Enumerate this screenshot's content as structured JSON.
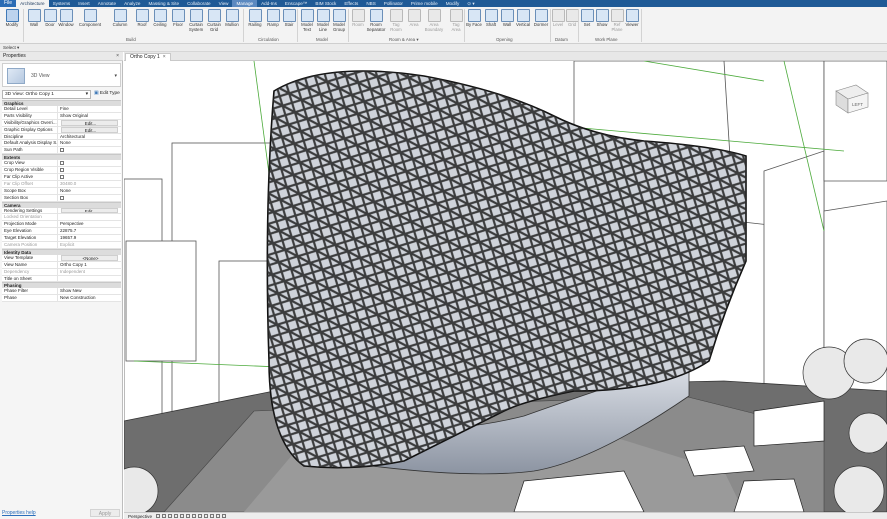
{
  "tabs": {
    "file": "File",
    "items": [
      "Architecture",
      "Systems",
      "Insert",
      "Annotate",
      "Analyze",
      "Massing & Site",
      "Collaborate",
      "View",
      "Manage",
      "Add-Ins",
      "Enscape™",
      "BIM Stock",
      "Effects",
      "NBS",
      "Pollinator",
      "Prime mobile",
      "Modify",
      "⊙ ▾"
    ]
  },
  "ribbon": {
    "buttons": [
      "Modify",
      "Wall",
      "Door",
      "Window",
      "Component",
      "Column",
      "Roof",
      "Ceiling",
      "Floor",
      "Curtain System",
      "Curtain Grid",
      "Mullion",
      "Railing",
      "Ramp",
      "Stair",
      "Model Text",
      "Model Line",
      "Model Group",
      "Room",
      "Room Separator",
      "Tag Room",
      "Area",
      "Area Boundary",
      "Tag Area",
      "By Face",
      "Shaft",
      "Wall",
      "Vertical",
      "Dormer",
      "Level",
      "Grid",
      "Set",
      "Show",
      "Ref Plane",
      "Viewer"
    ],
    "panels": [
      "Build",
      "Circulation",
      "Model",
      "Room & Area ▾",
      "Opening",
      "Datum",
      "Work Plane"
    ],
    "select_label": "Select ▾"
  },
  "properties": {
    "title": "Properties",
    "close": "×",
    "type_name": "3D View",
    "instance_selector": "3D View: Ortho Copy 1",
    "edit_type": "Edit Type",
    "groups": [
      {
        "name": "Graphics",
        "rows": [
          [
            "Detail Level",
            "Fine"
          ],
          [
            "Parts Visibility",
            "Show Original"
          ],
          [
            "Visibility/Graphics Overri...",
            "Edit..."
          ],
          [
            "Graphic Display Options",
            "Edit..."
          ],
          [
            "Discipline",
            "Architectural"
          ],
          [
            "Default Analysis Display S...",
            "None"
          ],
          [
            "Sun Path",
            ""
          ]
        ]
      },
      {
        "name": "Extents",
        "rows": [
          [
            "Crop View",
            ""
          ],
          [
            "Crop Region Visible",
            ""
          ],
          [
            "Far Clip Active",
            ""
          ],
          [
            "Far Clip Offset",
            "30480.0"
          ],
          [
            "Scope Box",
            "None"
          ],
          [
            "Section Box",
            ""
          ]
        ]
      },
      {
        "name": "Camera",
        "rows": [
          [
            "Rendering Settings",
            "Edit..."
          ],
          [
            "Locked Orientation",
            ""
          ],
          [
            "Projection Mode",
            "Perspective"
          ],
          [
            "Eye Elevation",
            "22875.7"
          ],
          [
            "Target Elevation",
            "19657.9"
          ],
          [
            "Camera Position",
            "Explicit"
          ]
        ]
      },
      {
        "name": "Identity Data",
        "rows": [
          [
            "View Template",
            "<None>"
          ],
          [
            "View Name",
            "Ortho Copy 1"
          ],
          [
            "Dependency",
            "Independent"
          ],
          [
            "Title on Sheet",
            ""
          ]
        ]
      },
      {
        "name": "Phasing",
        "rows": [
          [
            "Phase Filter",
            "Show New"
          ],
          [
            "Phase",
            "New Construction"
          ]
        ]
      }
    ],
    "help_link": "Properties help",
    "apply": "Apply"
  },
  "view_tab": {
    "label": "Ortho Copy 1",
    "close": "×"
  },
  "view_control": {
    "mode": "Perspective"
  },
  "viewcube": {
    "face": "LEFT"
  }
}
